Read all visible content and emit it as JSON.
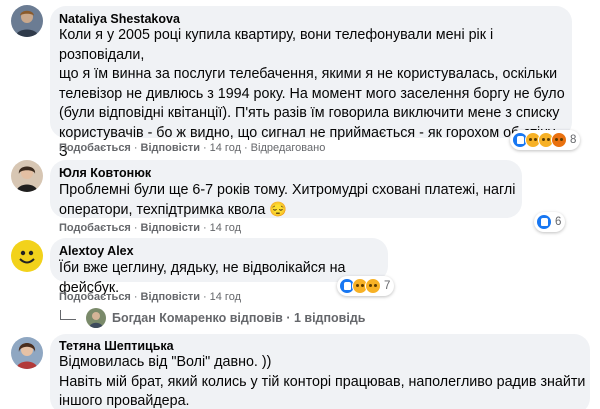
{
  "comments": [
    {
      "author": "Nataliya Shestakova",
      "text": "Коли я у 2005 році купила квартиру, вони телефонували мені рік і розповідали,\nщо я їм винна за послуги телебачення, якими я не користувалась, оскільки\nтелевізор не дивлюсь з 1994 року. На момент мого заселення боргу не було\n(були відповідні квітанції). П'ять разів їм говорила виключити мене з списку\nкористувачів - бо ж видно, що сигнал не приймається - як горохом об стіну. З\nтого часу ця компанія викликає у мене безумовну відразу.",
      "like_label": "Подобається",
      "reply_label": "Відповісти",
      "time": "14 год",
      "edited": "Відредаговано",
      "reaction_count": "8",
      "reactions": [
        "like-icon",
        "haha-icon",
        "wow-icon",
        "angry-icon"
      ]
    },
    {
      "author": "Юля Ковтонюк",
      "text": "Проблемні були ще 6-7 років тому. Хитромудрі сховані платежі, наглі\nоператори, техпідтримка квола 😔",
      "like_label": "Подобається",
      "reply_label": "Відповісти",
      "time": "14 год",
      "reaction_count": "6",
      "reactions": [
        "like-icon"
      ]
    },
    {
      "author": "Alextoy Alex",
      "text": "Їби вже цеглину, дядьку, не відволікайся на фейсбук.",
      "like_label": "Подобається",
      "reply_label": "Відповісти",
      "time": "14 год",
      "reaction_count": "7",
      "reactions": [
        "like-icon",
        "haha-icon",
        "sad-icon"
      ],
      "replies": "Богдан Комаренко відповів · 1 відповідь"
    },
    {
      "author": "Тетяна Шептицька",
      "text": "Відмовилась від \"Волі\" давно. ))\nНавіть мій брат, який колись у тій конторі працював, наполегливо радив знайти\nіншого провайдера.",
      "like_label": "",
      "reply_label": "",
      "time": ""
    }
  ],
  "separator": "·",
  "colors": {
    "bubble": "#f0f2f5",
    "meta_text": "#65676b",
    "like_blue": "#1877f2",
    "emoji_yellow": "#f7b125",
    "angry_orange": "#e9710f"
  }
}
